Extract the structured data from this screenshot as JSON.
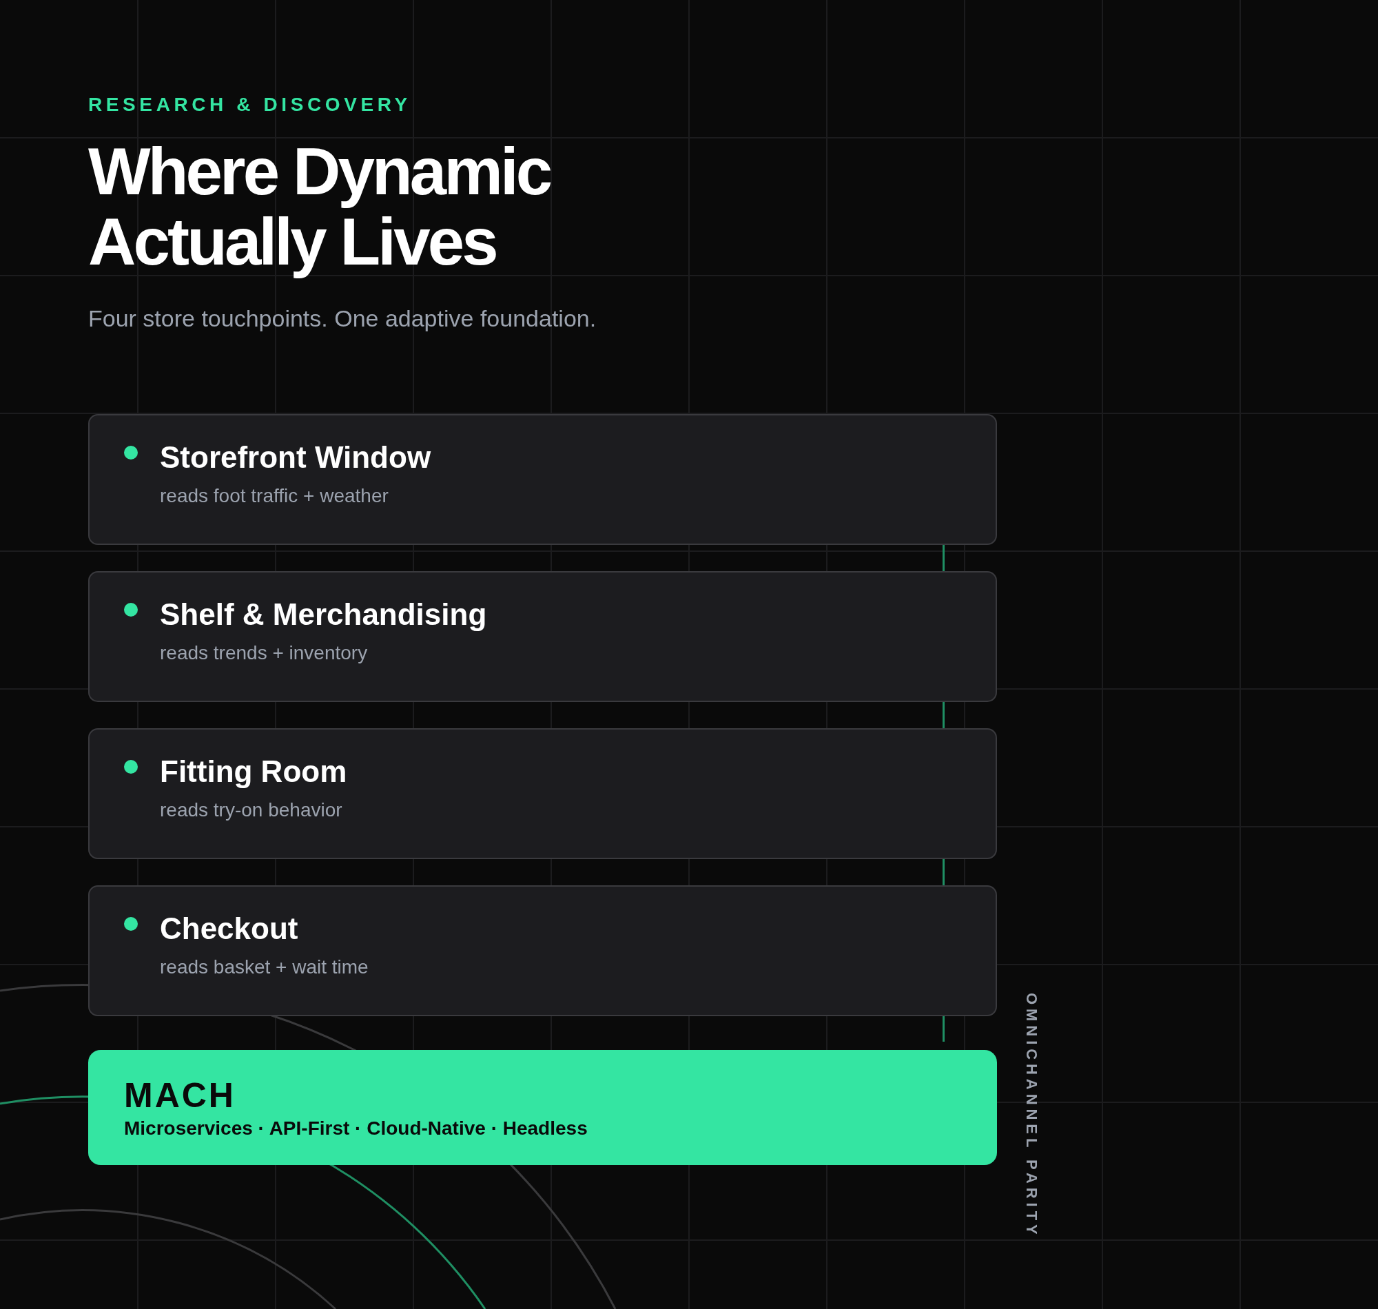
{
  "eyebrow": "RESEARCH & DISCOVERY",
  "title_lines": [
    "Where Dynamic",
    "Actually Lives"
  ],
  "subtitle": "Four store touchpoints. One adaptive foundation.",
  "touchpoints": [
    {
      "title": "Storefront Window",
      "detail": "reads foot traffic + weather"
    },
    {
      "title": "Shelf & Merchandising",
      "detail": "reads trends + inventory"
    },
    {
      "title": "Fitting Room",
      "detail": "reads try-on behavior"
    },
    {
      "title": "Checkout",
      "detail": "reads basket + wait time"
    }
  ],
  "foundation": {
    "title": "MACH",
    "pillars": "Microservices · API-First · Cloud-Native · Headless"
  },
  "side_label": "OMNICHANNEL PARITY"
}
